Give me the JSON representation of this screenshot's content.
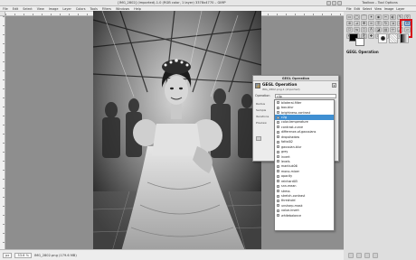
{
  "image_window": {
    "title": "[IMG_2802] (imported)-1.0 (RGB color, 1 layer) 3378x4770 – GIMP",
    "menu": [
      "File",
      "Edit",
      "Select",
      "View",
      "Image",
      "Layer",
      "Colors",
      "Tools",
      "Filters",
      "Windows",
      "Help"
    ],
    "status": {
      "unit": "px",
      "zoom": "33.6 %",
      "filename": "IMG_2802.png (179.6 MB)"
    }
  },
  "toolbox": {
    "title": "Toolbox – Tool Options",
    "menu": [
      "File",
      "Edit",
      "Select",
      "View",
      "Image",
      "Layer",
      "Colors",
      "Tools",
      "Filters",
      "Windows",
      "Help"
    ],
    "tool_options_label": "GEGL Operation"
  },
  "gegl_dialog": {
    "title": "GEGL Operation",
    "heading": "GEGL Operation",
    "subheading": "IMG_2802.png-1 (imported)",
    "operation_label": "Operation",
    "operation_value": "clip",
    "side_labels": [
      "Radius",
      "Sample",
      "Iterations",
      "Preview"
    ]
  },
  "operations_list": [
    {
      "label": "bilateral-filter"
    },
    {
      "label": "box-blur"
    },
    {
      "label": "brightness-contrast"
    },
    {
      "label": "c2g"
    },
    {
      "label": "color-temperature"
    },
    {
      "label": "contrast-curve"
    },
    {
      "label": "difference-of-gaussians"
    },
    {
      "label": "dropshadow"
    },
    {
      "label": "fattal02"
    },
    {
      "label": "gaussian-blur"
    },
    {
      "label": "grey"
    },
    {
      "label": "invert"
    },
    {
      "label": "levels"
    },
    {
      "label": "mantiuk06"
    },
    {
      "label": "mono-mixer"
    },
    {
      "label": "opacity"
    },
    {
      "label": "reinhard05"
    },
    {
      "label": "snn-mean"
    },
    {
      "label": "stress"
    },
    {
      "label": "stretch-contrast"
    },
    {
      "label": "threshold"
    },
    {
      "label": "unsharp-mask"
    },
    {
      "label": "value-invert"
    },
    {
      "label": "whitebalance"
    }
  ],
  "selected_operation_index": 3,
  "colors": {
    "selection": "#3f8fd2",
    "highlight": "#d6131a",
    "canvas": "#8e8e8e"
  }
}
